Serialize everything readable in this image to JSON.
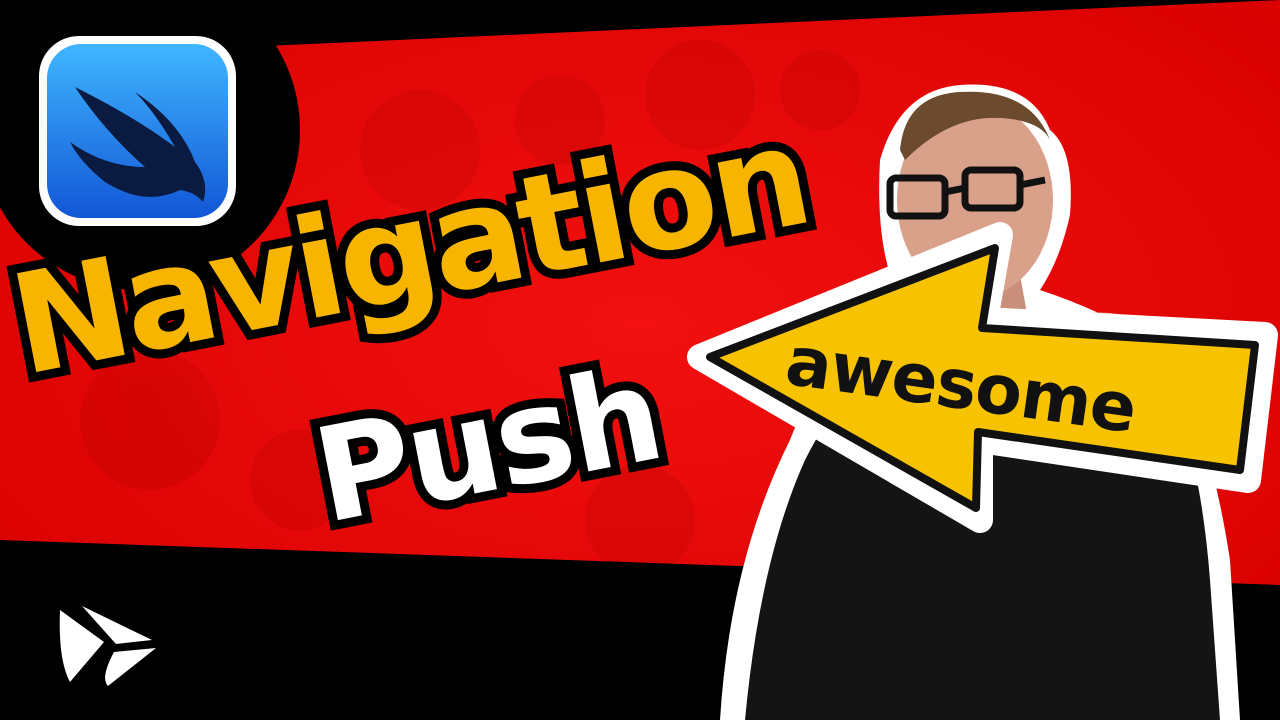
{
  "thumbnail": {
    "title_line_1": "Navigation",
    "title_line_2": "Push",
    "sign_text": "awesome"
  },
  "colors": {
    "background_red": "#ee0a0a",
    "band_black": "#000000",
    "title_yellow": "#f7b500",
    "title_white": "#ffffff",
    "sign_yellow": "#f7c200",
    "logo_blue": "#1c8cf0"
  },
  "icons": {
    "top_left": "swiftui-logo-icon",
    "bottom_left": "brand-logo-icon",
    "sign": "left-arrow-sign-icon"
  }
}
